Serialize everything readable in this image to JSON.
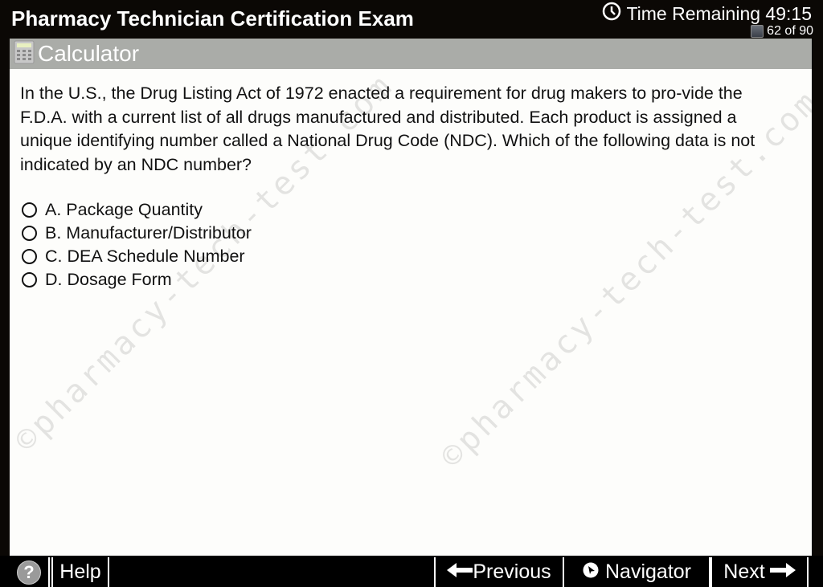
{
  "header": {
    "title": "Pharmacy Technician Certification Exam",
    "timer_label": "Time Remaining 49:15",
    "question_counter": "62 of 90"
  },
  "toolbar": {
    "calculator_label": "Calculator"
  },
  "question": {
    "text": "In the U.S., the Drug Listing Act of 1972 enacted a requirement for drug makers to pro-vide the F.D.A. with a current list of all drugs manufactured and distributed. Each product is assigned a unique identifying number called a National Drug Code (NDC). Which of the following data is not indicated by an NDC number?",
    "answers": [
      {
        "label": "A. Package Quantity"
      },
      {
        "label": "B. Manufacturer/Distributor"
      },
      {
        "label": "C. DEA Schedule Number"
      },
      {
        "label": "D. Dosage Form"
      }
    ]
  },
  "watermark": "©pharmacy-tech-test.com",
  "footer": {
    "help_icon": "?",
    "help_label": "Help",
    "previous_label": "Previous",
    "navigator_label": "Navigator",
    "next_label": "Next"
  }
}
